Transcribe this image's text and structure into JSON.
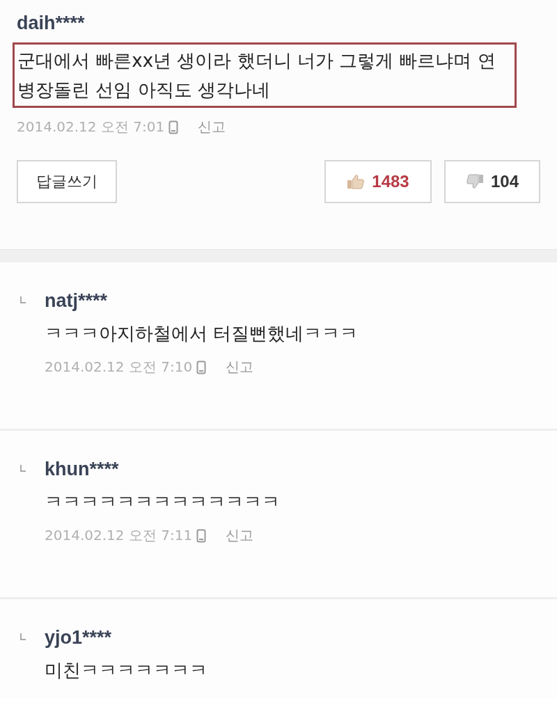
{
  "comment": {
    "username": "daih****",
    "text": "군대에서 빠른xx년 생이라 했더니 너가 그렇게 빠르냐며 연병장돌린 선임 아직도 생각나네",
    "highlighted": true,
    "date": "2014.02.12 오전 7:01",
    "report": "신고",
    "reply_button": "답글쓰기",
    "likes": "1483",
    "dislikes": "104"
  },
  "replies": [
    {
      "username": "natj****",
      "text": "ㅋㅋㅋ아지하철에서 터질뻔했네ㅋㅋㅋ",
      "date": "2014.02.12 오전 7:10",
      "report": "신고"
    },
    {
      "username": "khun****",
      "text": "ㅋㅋㅋㅋㅋㅋㅋㅋㅋㅋㅋㅋㅋ",
      "date": "2014.02.12 오전 7:11",
      "report": "신고"
    },
    {
      "username": "yjo1****",
      "text": "미친ㅋㅋㅋㅋㅋㅋㅋ"
    }
  ]
}
